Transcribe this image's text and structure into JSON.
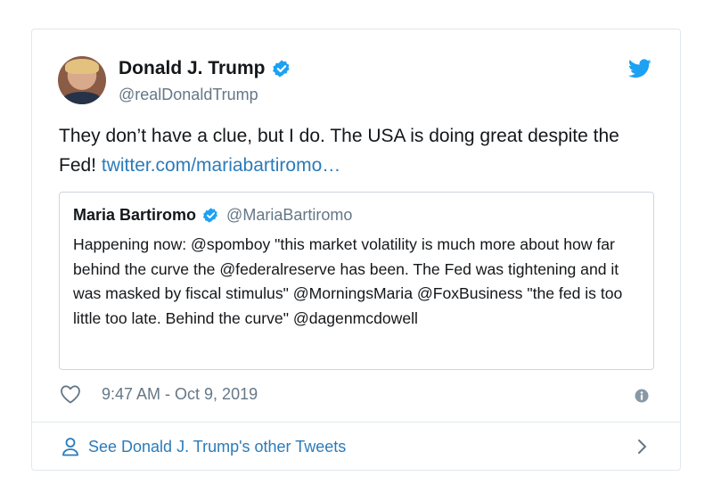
{
  "author": {
    "display_name": "Donald J. Trump",
    "handle": "@realDonaldTrump"
  },
  "tweet": {
    "text": "They don’t have a clue, but I do. The USA is doing great despite the Fed! ",
    "link": "twitter.com/mariabartiromo…"
  },
  "quoted_tweet": {
    "display_name": "Maria Bartiromo",
    "handle": "@MariaBartiromo",
    "text": "Happening now: @spomboy \"this market volatility is much more about how far behind the curve the @federalreserve has been. The Fed was tightening and it was masked by fiscal stimulus\" @MorningsMaria @FoxBusiness \"the fed is too little too late. Behind the curve\" @dagenmcdowell"
  },
  "meta": {
    "timestamp": "9:47 AM - Oct 9, 2019"
  },
  "footer": {
    "link_text": "See Donald J. Trump's other Tweets"
  },
  "colors": {
    "link": "#2b7bb9",
    "verified": "#1da1f2",
    "muted": "#657786",
    "border": "#e1e8ed"
  },
  "icons": [
    "verified-badge-icon",
    "twitter-bird-icon",
    "heart-icon",
    "info-icon",
    "person-icon",
    "chevron-right-icon"
  ]
}
